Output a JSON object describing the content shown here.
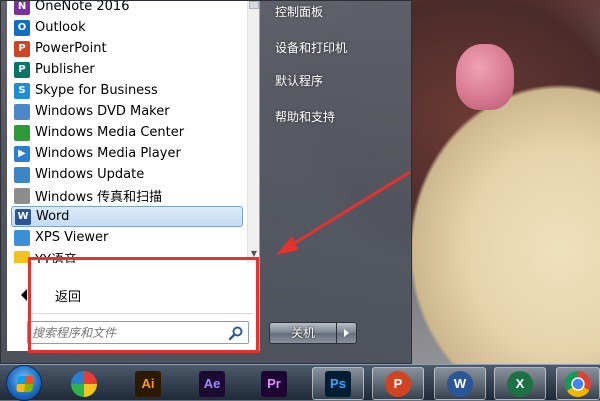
{
  "programs": [
    {
      "label": "OneNote 2016",
      "icon": "onenote-icon",
      "color": "#7b2f9a",
      "glyph": "N"
    },
    {
      "label": "Outlook",
      "icon": "outlook-icon",
      "color": "#0f6fc6",
      "glyph": "O"
    },
    {
      "label": "PowerPoint",
      "icon": "powerpoint-icon",
      "color": "#d04423",
      "glyph": "P"
    },
    {
      "label": "Publisher",
      "icon": "publisher-icon",
      "color": "#077568",
      "glyph": "P"
    },
    {
      "label": "Skype for Business",
      "icon": "skype-icon",
      "color": "#1c8fd6",
      "glyph": "S"
    },
    {
      "label": "Windows DVD Maker",
      "icon": "dvd-maker-icon",
      "color": "#4e87c8",
      "glyph": ""
    },
    {
      "label": "Windows Media Center",
      "icon": "media-center-icon",
      "color": "#2f9a3a",
      "glyph": ""
    },
    {
      "label": "Windows Media Player",
      "icon": "media-player-icon",
      "color": "#2b7fd0",
      "glyph": "▶"
    },
    {
      "label": "Windows Update",
      "icon": "windows-update-icon",
      "color": "#3d86c6",
      "glyph": ""
    },
    {
      "label": "Windows 传真和扫描",
      "icon": "fax-scan-icon",
      "color": "#8d8d8d",
      "glyph": ""
    },
    {
      "label": "Word",
      "icon": "word-icon",
      "color": "#2b579a",
      "glyph": "W",
      "selected": true
    },
    {
      "label": "XPS Viewer",
      "icon": "xps-viewer-icon",
      "color": "#3b8ed8",
      "glyph": ""
    },
    {
      "label": "YY语音",
      "icon": "yy-icon",
      "color": "#f2c21f",
      "glyph": ""
    }
  ],
  "start_menu": {
    "back_label": "返回",
    "search_placeholder": "搜索程序和文件",
    "right_links": [
      "控制面板",
      "设备和打印机",
      "默认程序",
      "帮助和支持"
    ],
    "shutdown_label": "关机"
  },
  "taskbar": {
    "apps": [
      {
        "name": "photos-app-icon",
        "text": "",
        "bg": "#ffffff",
        "fg": "#000000"
      },
      {
        "name": "illustrator-icon",
        "text": "Ai",
        "bg": "#2b1a00",
        "fg": "#ff9a00"
      },
      {
        "name": "after-effects-icon",
        "text": "Ae",
        "bg": "#1c0a33",
        "fg": "#9b8cff"
      },
      {
        "name": "premiere-icon",
        "text": "Pr",
        "bg": "#1c0433",
        "fg": "#e48cff"
      },
      {
        "name": "photoshop-icon",
        "text": "Ps",
        "bg": "#001d34",
        "fg": "#31a8ff"
      },
      {
        "name": "powerpoint-taskbar-icon",
        "text": "P",
        "bg": "#d04423",
        "fg": "#ffffff"
      },
      {
        "name": "word-taskbar-icon",
        "text": "W",
        "bg": "#2b579a",
        "fg": "#ffffff"
      },
      {
        "name": "excel-taskbar-icon",
        "text": "X",
        "bg": "#1e7145",
        "fg": "#ffffff"
      },
      {
        "name": "chrome-icon",
        "text": "",
        "bg": "#ffffff",
        "fg": "#000000"
      }
    ]
  },
  "colors": {
    "annotation": "#e5322f",
    "selection": "#c5dcf4"
  }
}
